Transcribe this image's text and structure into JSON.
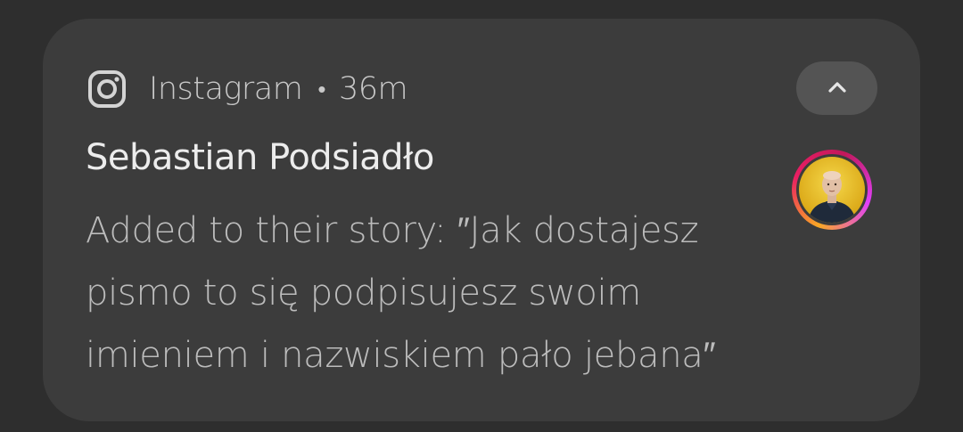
{
  "notification": {
    "app_name": "Instagram",
    "separator": "•",
    "time": "36m",
    "app_icon": "instagram-icon",
    "collapse_icon": "chevron-up-icon",
    "title": "Sebastian Podsiadło",
    "message": "Added to their story: ″Jak dostajesz pismo to się podpisujesz swoim imieniem i nazwiskiem pało jebana″",
    "avatar": "avatar-photo"
  },
  "colors": {
    "page_background": "#2e2e2e",
    "card_background": "#3c3c3c",
    "button_background": "#545454",
    "title_text": "#ececec",
    "body_text": "#bcbcbc",
    "ring_gradient": [
      "#f9a825",
      "#e91e63",
      "#c2185b",
      "#e040fb"
    ]
  }
}
